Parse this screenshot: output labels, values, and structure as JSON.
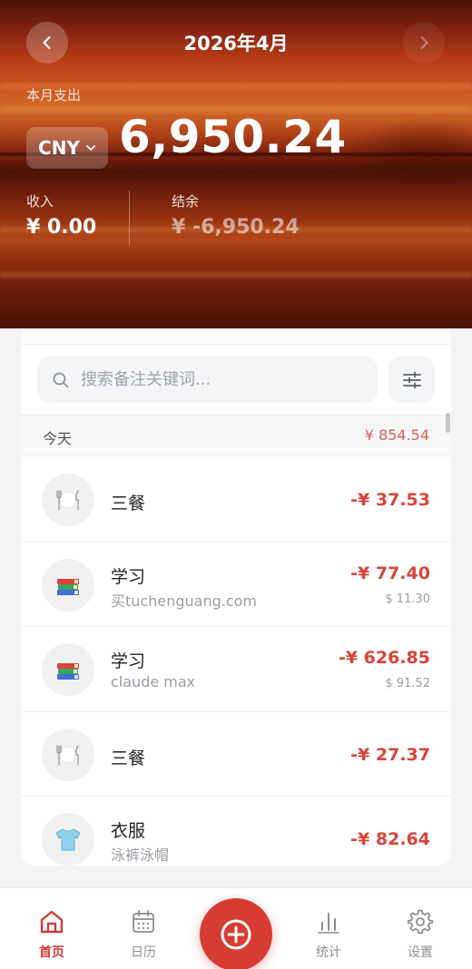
{
  "header": {
    "month_title": "2026年4月",
    "expense_label": "本月支出",
    "currency": "CNY",
    "expense_total": "6,950.24",
    "income_label": "收入",
    "income_value": "¥ 0.00",
    "balance_label": "结余",
    "balance_value": "¥ -6,950.24"
  },
  "search": {
    "placeholder": "搜索备注关键词..."
  },
  "day_group": {
    "label": "今天",
    "total": "¥ 854.54"
  },
  "transactions": [
    {
      "icon": "utensils-icon",
      "category": "三餐",
      "note": "",
      "amount": "-¥ 37.53",
      "usd": ""
    },
    {
      "icon": "books-icon",
      "category": "学习",
      "note": "买tuchenguang.com",
      "amount": "-¥ 77.40",
      "usd": "$ 11.30"
    },
    {
      "icon": "books-icon",
      "category": "学习",
      "note": "claude max",
      "amount": "-¥ 626.85",
      "usd": "$ 91.52"
    },
    {
      "icon": "utensils-icon",
      "category": "三餐",
      "note": "",
      "amount": "-¥ 27.37",
      "usd": ""
    },
    {
      "icon": "tshirt-icon",
      "category": "衣服",
      "note": "泳裤泳帽",
      "amount": "-¥ 82.64",
      "usd": ""
    }
  ],
  "bottom_nav": {
    "home": "首页",
    "calendar": "日历",
    "stats": "统计",
    "settings": "设置"
  },
  "colors": {
    "accent": "#d73c33",
    "expense_red": "#d9443b"
  }
}
